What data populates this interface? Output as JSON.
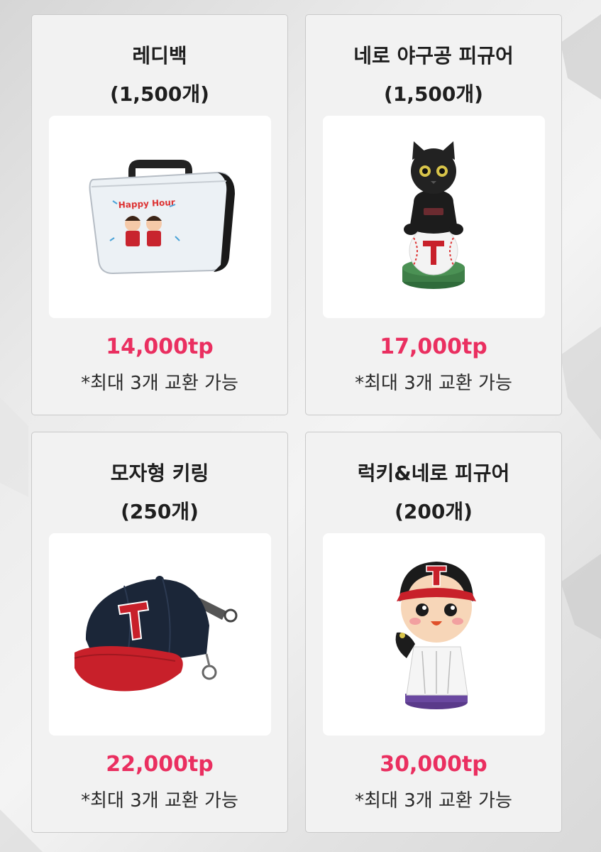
{
  "items": [
    {
      "name": "레디백",
      "qty": "(1,500개)",
      "price": "14,000tp",
      "limit": "*최대 3개 교환 가능",
      "image_icon": "carry-bag-icon"
    },
    {
      "name": "네로 야구공 피규어",
      "qty": "(1,500개)",
      "price": "17,000tp",
      "limit": "*최대 3개 교환 가능",
      "image_icon": "cat-figure-icon"
    },
    {
      "name": "모자형 키링",
      "qty": "(250개)",
      "price": "22,000tp",
      "limit": "*최대 3개 교환 가능",
      "image_icon": "cap-keyring-icon"
    },
    {
      "name": "럭키&네로 피규어",
      "qty": "(200개)",
      "price": "30,000tp",
      "limit": "*최대 3개 교환 가능",
      "image_icon": "player-figure-icon"
    }
  ],
  "bag_print": "Happy Hour",
  "colors": {
    "price": "#ea2f60",
    "card_bg": "#f2f2f2",
    "card_border": "#c9c9c9",
    "image_bg": "#ffffff",
    "team_red": "#d0202a",
    "team_navy": "#1b2638"
  }
}
